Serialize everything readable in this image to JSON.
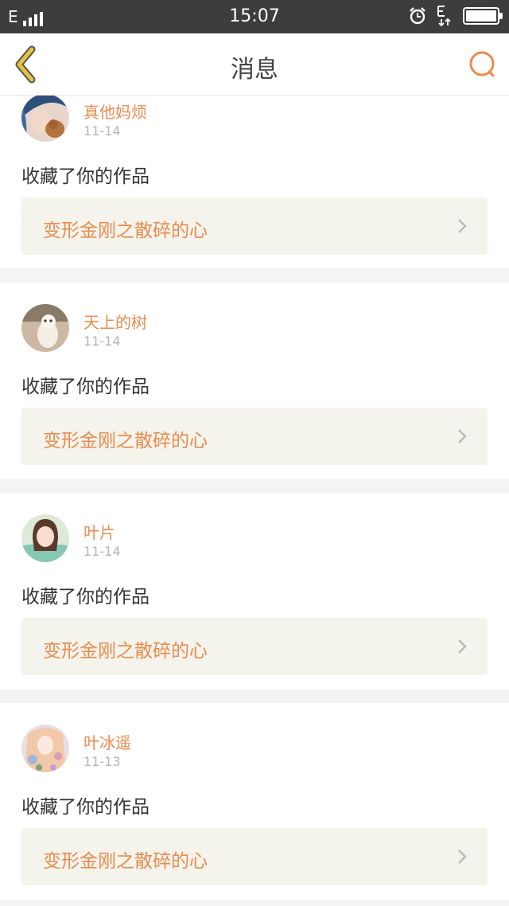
{
  "status_bar": {
    "network": "E",
    "time": "15:07",
    "battery_level": 1.0,
    "icons": [
      "signal-icon",
      "alarm-icon",
      "data-transfer-icon",
      "battery-icon"
    ]
  },
  "header": {
    "title": "消息",
    "back_icon": "back-chevron-icon",
    "search_icon": "search-icon"
  },
  "colors": {
    "accent": "#e98c4e",
    "back_icon": "#e6c23a",
    "status_bar": "#3d3d3d",
    "link_bg": "#f4f3ec"
  },
  "notifications": [
    {
      "user": "真他妈烦",
      "date": "11-14",
      "action": "收藏了你的作品",
      "work_title": "变形金刚之散碎的心"
    },
    {
      "user": "天上的树",
      "date": "11-14",
      "action": "收藏了你的作品",
      "work_title": "变形金刚之散碎的心"
    },
    {
      "user": "叶片",
      "date": "11-14",
      "action": "收藏了你的作品",
      "work_title": "变形金刚之散碎的心"
    },
    {
      "user": "叶冰遥",
      "date": "11-13",
      "action": "收藏了你的作品",
      "work_title": "变形金刚之散碎的心"
    }
  ]
}
